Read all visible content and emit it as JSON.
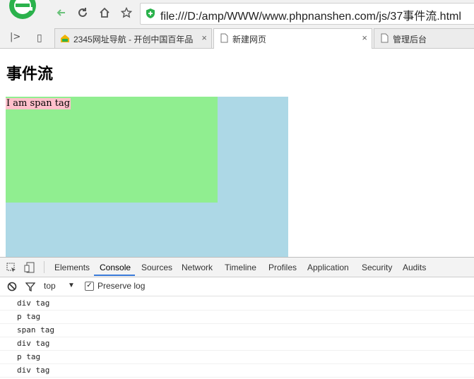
{
  "browser": {
    "address_url": "file:///D:/amp/WWW/www.phpnanshen.com/js/37事件流.html",
    "tabs": [
      {
        "title": "2345网址导航 - 开创中国百年品",
        "close": "×"
      },
      {
        "title": "新建网页",
        "close": "×"
      },
      {
        "title": "管理后台",
        "close": ""
      }
    ]
  },
  "page": {
    "heading": "事件流",
    "span_text": "I am span tag"
  },
  "devtools": {
    "tabs": [
      "Elements",
      "Console",
      "Sources",
      "Network",
      "Timeline",
      "Profiles",
      "Application",
      "Security",
      "Audits"
    ],
    "active_tab": "Console",
    "context": "top",
    "preserve_log_label": "Preserve log",
    "console_lines": [
      "div tag",
      "p tag",
      "span tag",
      "div tag",
      "p tag",
      "div tag"
    ]
  }
}
